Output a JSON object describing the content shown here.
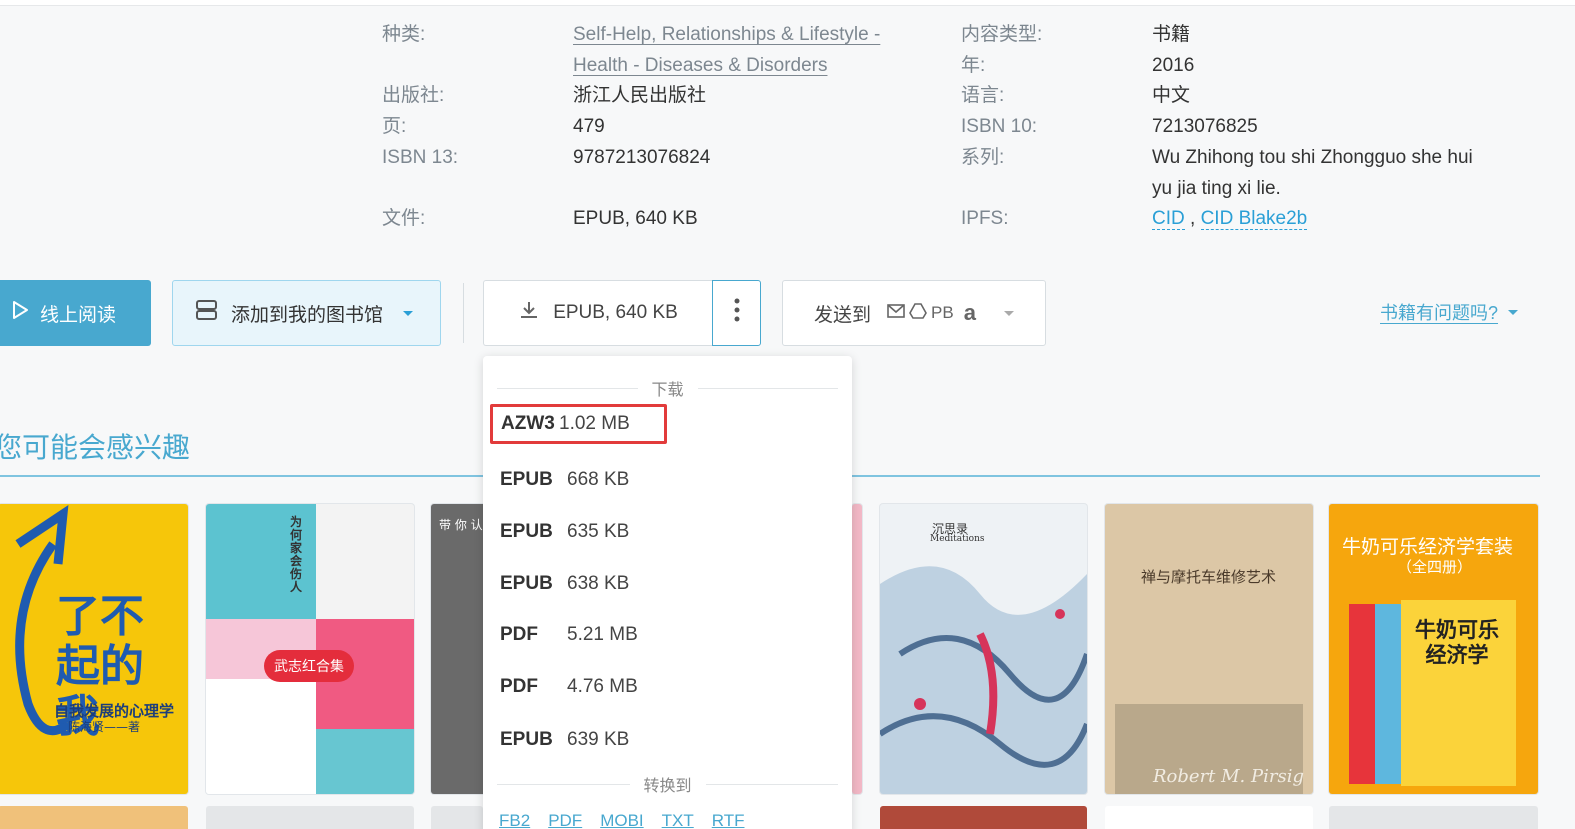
{
  "details": {
    "left_col": [
      {
        "label": "种类:",
        "value_lines": [
          "Self-Help, Relationships & Lifestyle -",
          "Health - Diseases & Disorders"
        ]
      },
      {
        "label": "出版社:",
        "value": "浙江人民出版社"
      },
      {
        "label": "页:",
        "value": "479"
      },
      {
        "label": "ISBN 13:",
        "value": "9787213076824"
      },
      {
        "label": "文件:",
        "value": "EPUB, 640 KB"
      }
    ],
    "right_col": [
      {
        "label": "内容类型:",
        "value": "书籍"
      },
      {
        "label": "年:",
        "value": "2016"
      },
      {
        "label": "语言:",
        "value": "中文"
      },
      {
        "label": "ISBN 10:",
        "value": "7213076825"
      },
      {
        "label": "系列:",
        "value_lines": [
          "Wu Zhihong tou shi Zhongguo she hui",
          "yu jia ting xi lie."
        ]
      },
      {
        "label": "IPFS:",
        "links": [
          "CID",
          "CID Blake2b"
        ],
        "sep": " , "
      }
    ]
  },
  "actions": {
    "read_online": "线上阅读",
    "add_library": "添加到我的图书馆",
    "download": "EPUB, 640 KB",
    "send_to": "发送到",
    "send_pb": "PB",
    "send_amazon": "a",
    "report": "书籍有问题吗?"
  },
  "section_title": "您可能会感兴趣",
  "dropdown": {
    "download_heading": "下载",
    "items": [
      {
        "format": "AZW3",
        "size": "1.02 MB",
        "highlighted": true
      },
      {
        "format": "EPUB",
        "size": "668 KB"
      },
      {
        "format": "EPUB",
        "size": "635 KB"
      },
      {
        "format": "EPUB",
        "size": "638 KB"
      },
      {
        "format": "PDF",
        "size": "5.21 MB"
      },
      {
        "format": "PDF",
        "size": "4.76 MB"
      },
      {
        "format": "EPUB",
        "size": "639 KB"
      }
    ],
    "convert_heading": "转换到",
    "convert_options": [
      "FB2",
      "PDF",
      "MOBI",
      "TXT",
      "RTF"
    ]
  },
  "covers": {
    "c1_title": "了不起的我",
    "c1_sub": "自我发展的心理学",
    "c1_author": "陈海贤——著",
    "c2_title": "为何家会伤人",
    "c2_badge": "武志红合集",
    "c3_title": "带 你 认",
    "c5_title": "沉思录",
    "c5_en": "Meditations",
    "c6_title": "禅与摩托车维修艺术",
    "c6_author": "Robert M. Pirsig",
    "c7_title": "牛奶可乐经济学套装",
    "c7_sub": "（全四册）",
    "c7_book": "牛奶可乐经济学"
  },
  "colors": {
    "accent": "#48a8cf",
    "highlight_border": "#e23b3b",
    "label_gray": "#7d8790"
  }
}
